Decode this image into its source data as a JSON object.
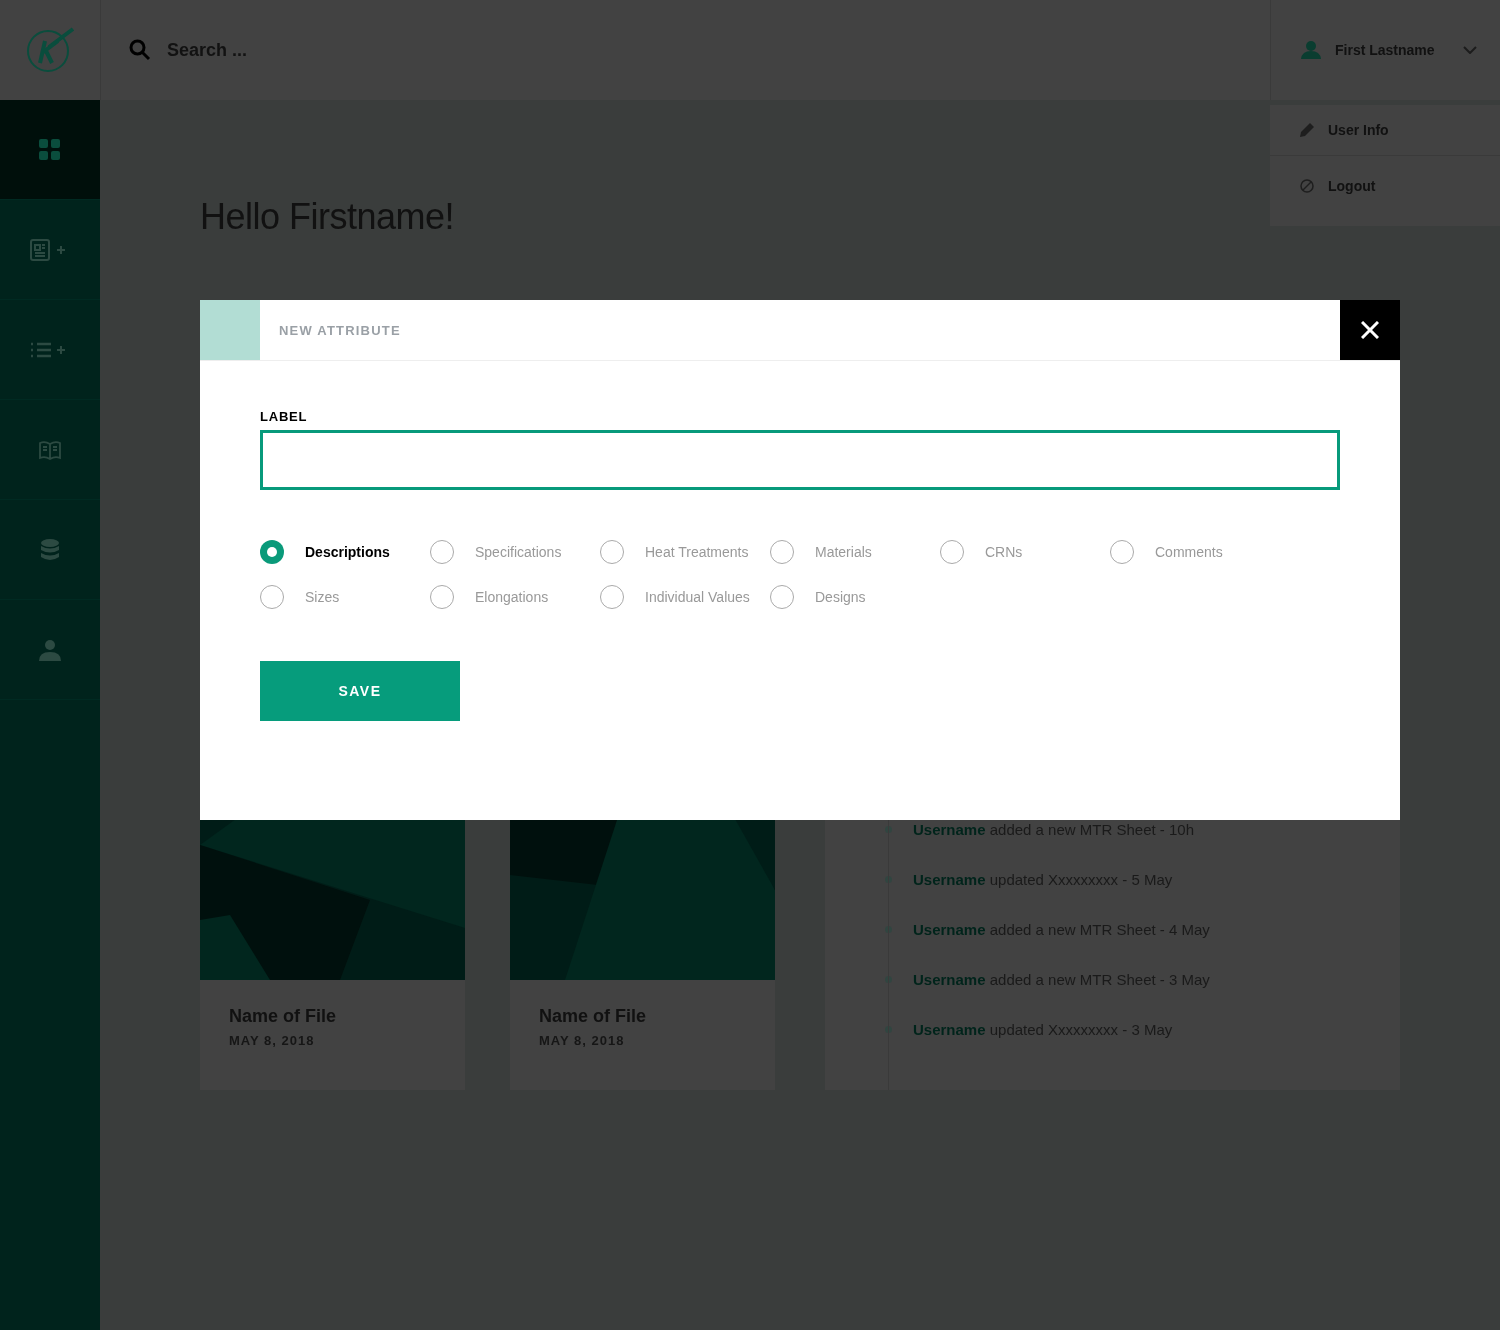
{
  "topbar": {
    "search": {
      "placeholder": "Search ..."
    },
    "user": {
      "name": "First Lastname"
    }
  },
  "user_menu": {
    "items": [
      {
        "label": "User Info"
      },
      {
        "label": "Logout"
      }
    ]
  },
  "sidebar": {
    "items": [
      {
        "selected": true
      },
      {
        "selected": false
      },
      {
        "selected": false
      },
      {
        "selected": false
      },
      {
        "selected": false
      },
      {
        "selected": false
      }
    ]
  },
  "greeting": "Hello Firstname!",
  "files": [
    {
      "name": "Name of File",
      "date": "MAY 8, 2018"
    },
    {
      "name": "Name of File",
      "date": "MAY 8, 2018"
    }
  ],
  "activity": [
    {
      "user": "Username",
      "action": "added a new MTR Sheet",
      "time": "- 10h"
    },
    {
      "user": "Username",
      "action": "updated Xxxxxxxxx",
      "time": "- 5 May"
    },
    {
      "user": "Username",
      "action": "added a new MTR Sheet",
      "time": "- 4 May"
    },
    {
      "user": "Username",
      "action": "added a new MTR Sheet",
      "time": "- 3 May"
    },
    {
      "user": "Username",
      "action": "updated Xxxxxxxxx",
      "time": "- 3 May"
    }
  ],
  "modal": {
    "title": "NEW ATTRIBUTE",
    "field": {
      "label": "LABEL"
    },
    "options": [
      {
        "label": "Descriptions",
        "selected": true
      },
      {
        "label": "Specifications",
        "selected": false
      },
      {
        "label": "Heat Treatments",
        "selected": false
      },
      {
        "label": "Materials",
        "selected": false
      },
      {
        "label": "CRNs",
        "selected": false
      },
      {
        "label": "Comments",
        "selected": false
      },
      {
        "label": "Sizes",
        "selected": false
      },
      {
        "label": "Elongations",
        "selected": false
      },
      {
        "label": "Individual Values",
        "selected": false
      },
      {
        "label": "Designs",
        "selected": false
      }
    ],
    "save_button": "SAVE"
  }
}
